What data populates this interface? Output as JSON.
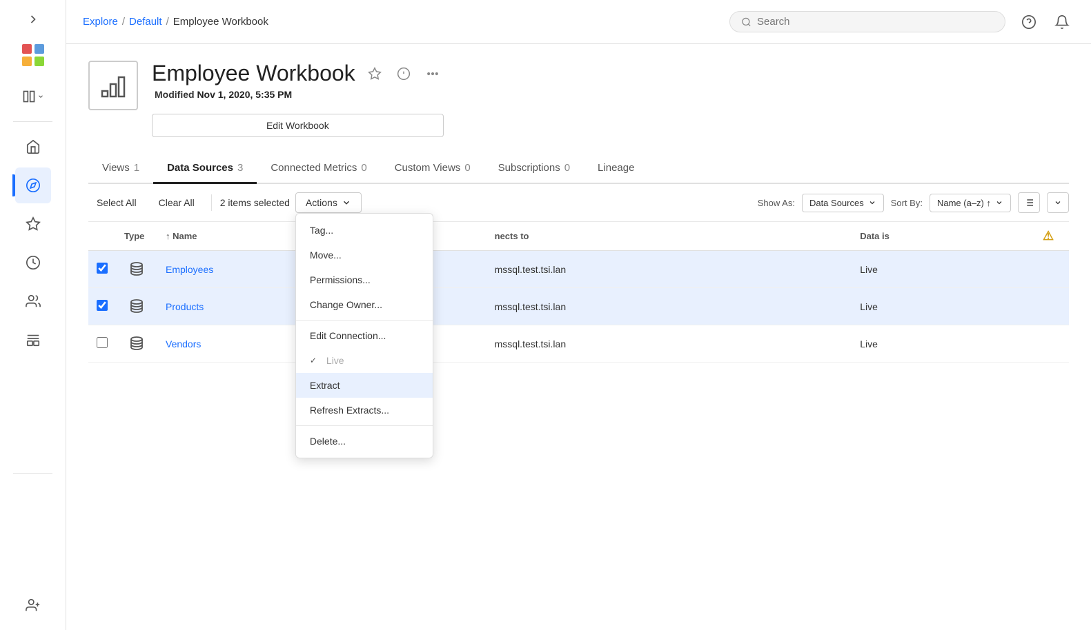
{
  "sidebar": {
    "expand_label": "Expand sidebar",
    "items": [
      {
        "id": "home",
        "icon": "home",
        "label": "Home",
        "active": false
      },
      {
        "id": "discover",
        "icon": "compass",
        "label": "Discover",
        "active": true
      },
      {
        "id": "favorites",
        "icon": "star",
        "label": "Favorites",
        "active": false
      },
      {
        "id": "recents",
        "icon": "clock",
        "label": "Recents",
        "active": false
      },
      {
        "id": "shared",
        "icon": "users",
        "label": "Shared with me",
        "active": false
      },
      {
        "id": "collections",
        "icon": "box",
        "label": "Collections",
        "active": false
      }
    ],
    "bottom_items": [
      {
        "id": "users-admin",
        "icon": "users-admin",
        "label": "Users",
        "active": false
      }
    ]
  },
  "topbar": {
    "breadcrumb": {
      "explore": "Explore",
      "default": "Default",
      "current": "Employee Workbook",
      "separator": "/"
    },
    "search": {
      "placeholder": "Search"
    }
  },
  "workbook": {
    "title": "Employee Workbook",
    "modified_label": "Modified",
    "modified_date": "Nov 1, 2020, 5:35 PM",
    "edit_btn": "Edit Workbook"
  },
  "tabs": [
    {
      "id": "views",
      "label": "Views",
      "count": "1",
      "active": false
    },
    {
      "id": "data-sources",
      "label": "Data Sources",
      "count": "3",
      "active": true
    },
    {
      "id": "connected-metrics",
      "label": "Connected Metrics",
      "count": "0",
      "active": false
    },
    {
      "id": "custom-views",
      "label": "Custom Views",
      "count": "0",
      "active": false
    },
    {
      "id": "subscriptions",
      "label": "Subscriptions",
      "count": "0",
      "active": false
    },
    {
      "id": "lineage",
      "label": "Lineage",
      "count": "",
      "active": false
    }
  ],
  "toolbar": {
    "select_all": "Select All",
    "clear_all": "Clear All",
    "selected_count": "2 items selected",
    "actions": "Actions",
    "show_as_label": "Show As:",
    "show_as_value": "Data Sources",
    "sort_by_label": "Sort By:",
    "sort_by_value": "Name (a–z) ↑"
  },
  "table": {
    "columns": [
      {
        "id": "checkbox",
        "label": ""
      },
      {
        "id": "type",
        "label": "Type"
      },
      {
        "id": "name",
        "label": "Name",
        "sortable": true,
        "sort_dir": "asc"
      },
      {
        "id": "connects_to",
        "label": "nects to"
      },
      {
        "id": "data_is",
        "label": "Data is"
      },
      {
        "id": "warning",
        "label": "⚠"
      }
    ],
    "rows": [
      {
        "id": 1,
        "selected": true,
        "type": "datasource",
        "name": "Employees",
        "connects_to": "mssql.test.tsi.lan",
        "data_is": "Live"
      },
      {
        "id": 2,
        "selected": true,
        "type": "datasource",
        "name": "Products",
        "connects_to": "mssql.test.tsi.lan",
        "data_is": "Live"
      },
      {
        "id": 3,
        "selected": false,
        "type": "datasource",
        "name": "Vendors",
        "connects_to": "mssql.test.tsi.lan",
        "data_is": "Live"
      }
    ]
  },
  "dropdown": {
    "items": [
      {
        "id": "tag",
        "label": "Tag...",
        "group": 1,
        "disabled": false,
        "highlighted": false
      },
      {
        "id": "move",
        "label": "Move...",
        "group": 1,
        "disabled": false,
        "highlighted": false
      },
      {
        "id": "permissions",
        "label": "Permissions...",
        "group": 1,
        "disabled": false,
        "highlighted": false
      },
      {
        "id": "change-owner",
        "label": "Change Owner...",
        "group": 1,
        "disabled": false,
        "highlighted": false
      },
      {
        "id": "edit-connection",
        "label": "Edit Connection...",
        "group": 2,
        "disabled": false,
        "highlighted": false
      },
      {
        "id": "live",
        "label": "Live",
        "group": 2,
        "disabled": true,
        "highlighted": false,
        "checked": true
      },
      {
        "id": "extract",
        "label": "Extract",
        "group": 2,
        "disabled": false,
        "highlighted": true
      },
      {
        "id": "refresh-extracts",
        "label": "Refresh Extracts...",
        "group": 2,
        "disabled": false,
        "highlighted": false
      },
      {
        "id": "delete",
        "label": "Delete...",
        "group": 3,
        "disabled": false,
        "highlighted": false
      }
    ]
  }
}
